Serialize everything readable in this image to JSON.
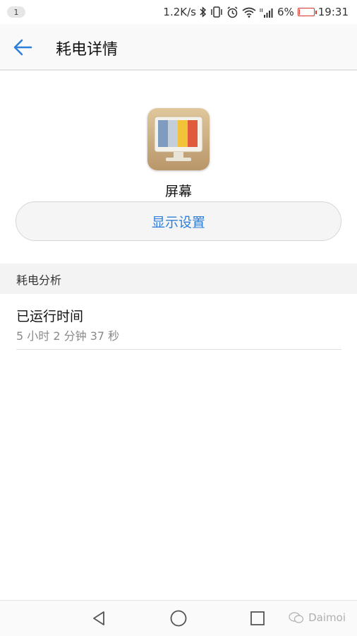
{
  "status_bar": {
    "notification_count": "1",
    "net_speed": "1.2K/s",
    "battery_percent": "6%",
    "time": "19:31",
    "battery_level": 0.06,
    "icons": [
      "bluetooth-icon",
      "vibrate-icon",
      "alarm-icon",
      "wifi-icon",
      "signal-icon",
      "battery-icon"
    ]
  },
  "app_bar": {
    "title": "耗电详情",
    "back_icon": "arrow-left-icon",
    "accent_color": "#2f7ed8"
  },
  "app_info": {
    "icon": "monitor-icon",
    "name": "屏幕",
    "settings_button": "显示设置"
  },
  "section": {
    "header": "耗电分析",
    "items": [
      {
        "title": "已运行时间",
        "value": "5 小时 2 分钟 37 秒"
      }
    ]
  },
  "nav_bar": {
    "buttons": [
      "back-triangle-icon",
      "home-circle-icon",
      "recents-square-icon"
    ]
  },
  "watermark": {
    "text": "Daimoi"
  }
}
